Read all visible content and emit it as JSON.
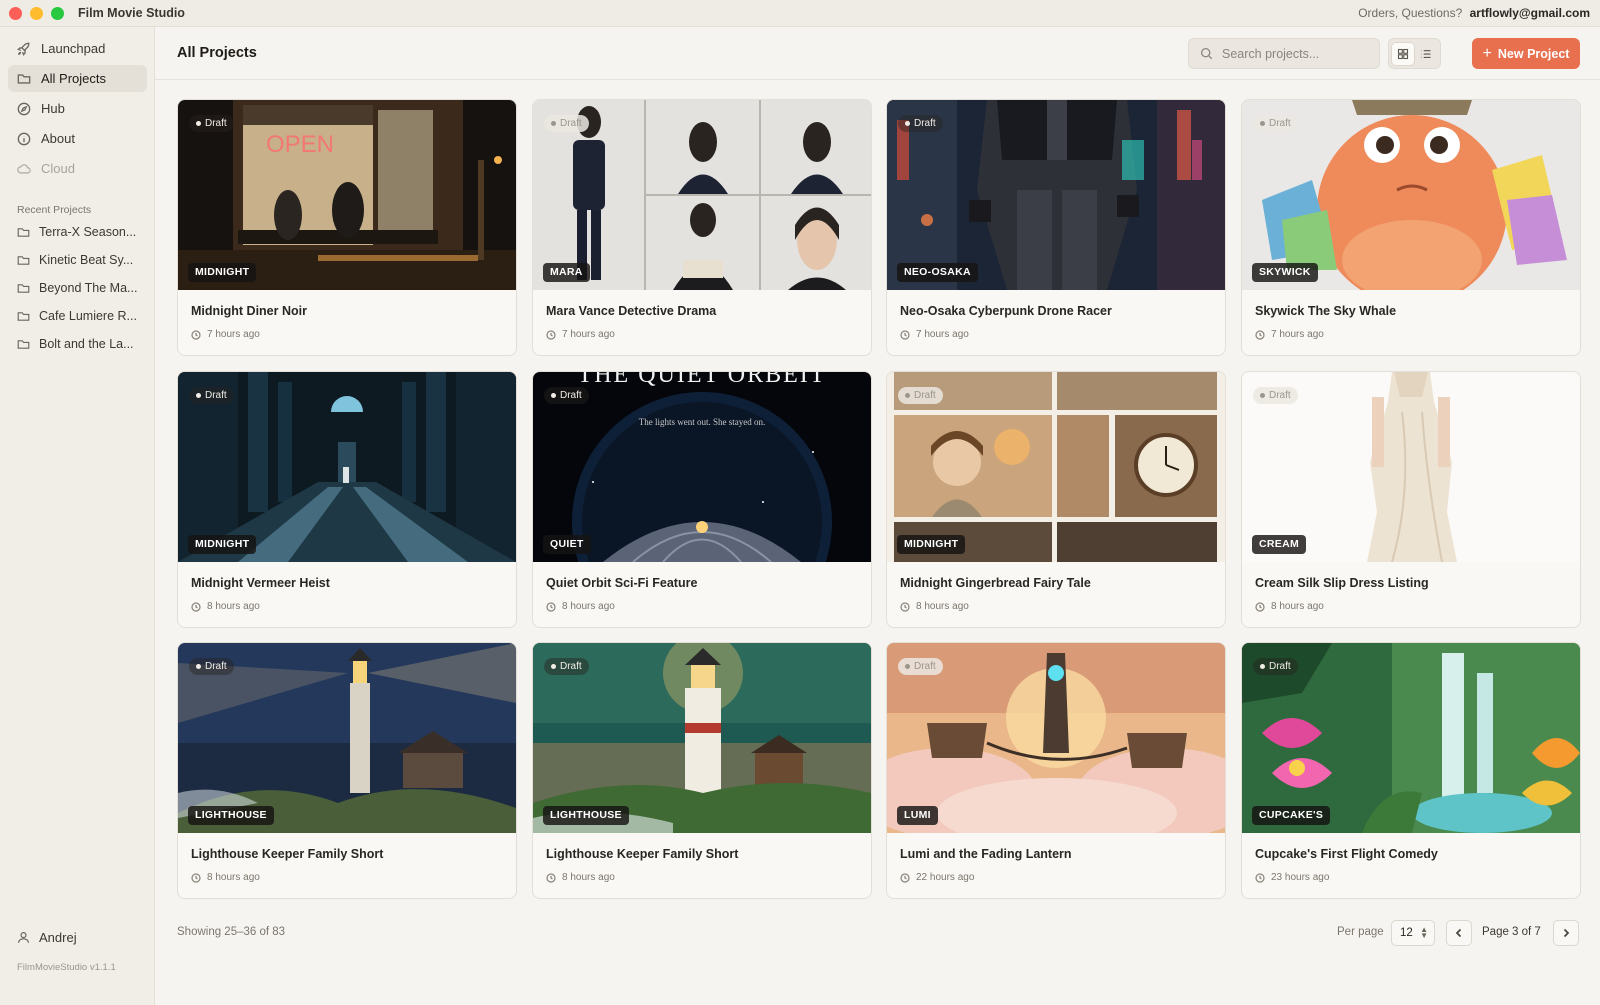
{
  "app": {
    "title": "Film Movie Studio",
    "support_text": "Orders, Questions?",
    "support_email": "artflowly@gmail.com"
  },
  "sidebar": {
    "nav": [
      {
        "label": "Launchpad",
        "icon": "rocket-icon"
      },
      {
        "label": "All Projects",
        "icon": "folder-icon",
        "active": true
      },
      {
        "label": "Hub",
        "icon": "compass-icon"
      },
      {
        "label": "About",
        "icon": "info-icon"
      },
      {
        "label": "Cloud",
        "icon": "cloud-icon",
        "disabled": true
      }
    ],
    "recent_label": "Recent Projects",
    "recent": [
      {
        "label": "Terra-X Season..."
      },
      {
        "label": "Kinetic Beat Sy..."
      },
      {
        "label": "Beyond The Ma..."
      },
      {
        "label": "Cafe Lumiere R..."
      },
      {
        "label": "Bolt and the La..."
      }
    ],
    "user": "Andrej",
    "version": "FilmMovieStudio v1.1.1"
  },
  "header": {
    "title": "All Projects",
    "search_placeholder": "Search projects...",
    "new_project_label": "New Project"
  },
  "projects": [
    {
      "title": "Midnight Diner Noir",
      "tag": "MIDNIGHT",
      "time": "7 hours ago",
      "status": "Draft"
    },
    {
      "title": "Mara Vance Detective Drama",
      "tag": "MARA",
      "time": "7 hours ago",
      "status": "Draft"
    },
    {
      "title": "Neo-Osaka Cyberpunk Drone Racer",
      "tag": "NEO-OSAKA",
      "time": "7 hours ago",
      "status": "Draft"
    },
    {
      "title": "Skywick The Sky Whale",
      "tag": "SKYWICK",
      "time": "7 hours ago",
      "status": "Draft"
    },
    {
      "title": "Midnight Vermeer Heist",
      "tag": "MIDNIGHT",
      "time": "8 hours ago",
      "status": "Draft"
    },
    {
      "title": "Quiet Orbit Sci-Fi Feature",
      "tag": "QUIET",
      "time": "8 hours ago",
      "status": "Draft",
      "poster_title": "THE QUIET ORBEIT",
      "poster_tagline": "The lights went out. She stayed on."
    },
    {
      "title": "Midnight Gingerbread Fairy Tale",
      "tag": "MIDNIGHT",
      "time": "8 hours ago",
      "status": "Draft"
    },
    {
      "title": "Cream Silk Slip Dress Listing",
      "tag": "CREAM",
      "time": "8 hours ago",
      "status": "Draft"
    },
    {
      "title": "Lighthouse Keeper Family Short",
      "tag": "LIGHTHOUSE",
      "time": "8 hours ago",
      "status": "Draft"
    },
    {
      "title": "Lighthouse Keeper Family Short",
      "tag": "LIGHTHOUSE",
      "time": "8 hours ago",
      "status": "Draft"
    },
    {
      "title": "Lumi and the Fading Lantern",
      "tag": "LUMI",
      "time": "22 hours ago",
      "status": "Draft"
    },
    {
      "title": "Cupcake's First Flight Comedy",
      "tag": "CUPCAKE'S",
      "time": "23 hours ago",
      "status": "Draft"
    }
  ],
  "pagination": {
    "showing": "Showing 25–36 of 83",
    "per_page_label": "Per page",
    "per_page_value": "12",
    "page_info": "Page 3 of 7"
  },
  "colors": {
    "accent": "#e8704f",
    "background": "#f6f4f0",
    "sidebar": "#f1eee8"
  }
}
